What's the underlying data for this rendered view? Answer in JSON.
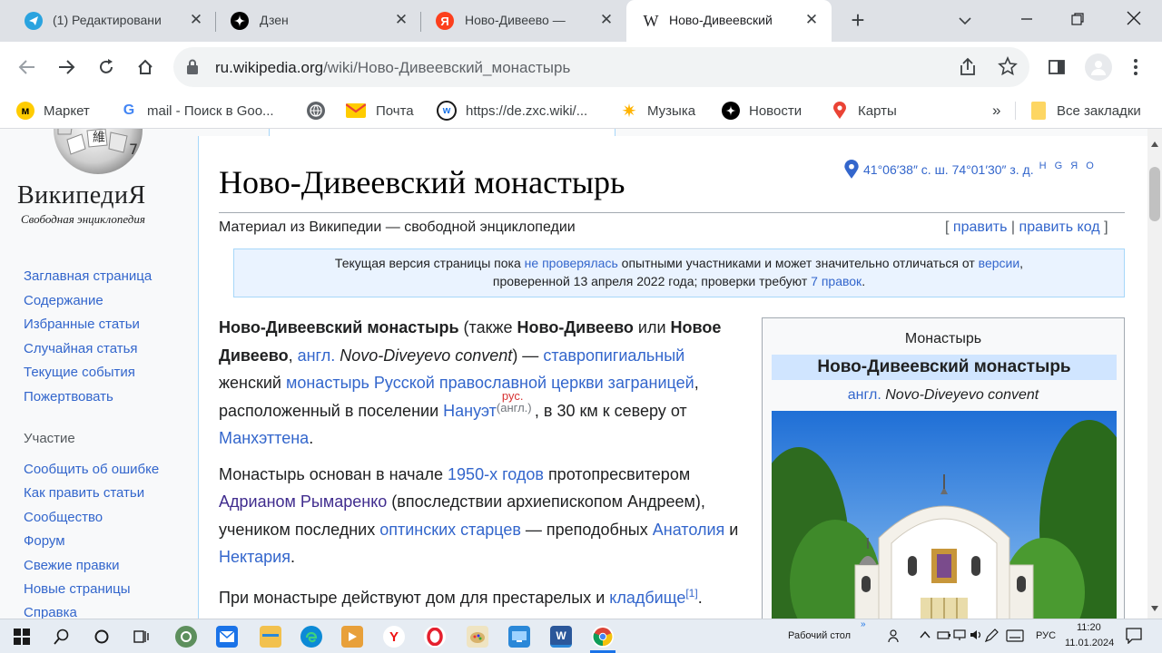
{
  "browser": {
    "tabs": [
      {
        "title": "(1) Редактировани",
        "favicon": "telegram-icon",
        "active": false
      },
      {
        "title": "Дзен",
        "favicon": "dzen-icon",
        "active": false
      },
      {
        "title": "Ново-Дивеево —",
        "favicon": "yandex-icon",
        "active": false
      },
      {
        "title": "Ново-Дивеевский",
        "favicon": "wikipedia-icon",
        "active": true
      }
    ],
    "new_tab": "+",
    "url_host": "ru.wikipedia.org",
    "url_path": "/wiki/Ново-Дивеевский_монастырь"
  },
  "bookmarks": {
    "items": [
      {
        "label": "Маркет",
        "icon": "market-icon",
        "color": "#ffcc00"
      },
      {
        "label": "mail - Поиск в Goo...",
        "icon": "google-icon",
        "color": "#4285f4"
      },
      {
        "label": "",
        "icon": "globe-icon",
        "color": "#5f6368"
      },
      {
        "label": "Почта",
        "icon": "mail-icon",
        "color": "#ea4335"
      },
      {
        "label": "https://de.zxc.wiki/...",
        "icon": "zxc-wiki-icon",
        "color": "#1a73e8"
      },
      {
        "label": "Музыка",
        "icon": "music-icon",
        "color": "#ffb300"
      },
      {
        "label": "Новости",
        "icon": "news-icon",
        "color": "#000000"
      },
      {
        "label": "Карты",
        "icon": "maps-icon",
        "color": "#ea4335"
      }
    ],
    "overflow": "»",
    "all_bookmarks": "Все закладки"
  },
  "sidebar": {
    "logo_title": "ВикипедиЯ",
    "logo_tagline": "Свободная энциклопедия",
    "nav": [
      "Заглавная страница",
      "Содержание",
      "Избранные статьи",
      "Случайная статья",
      "Текущие события",
      "Пожертвовать"
    ],
    "participation_heading": "Участие",
    "participation": [
      "Сообщить об ошибке",
      "Как править статьи",
      "Сообщество",
      "Форум",
      "Свежие правки",
      "Новые страницы",
      "Справка"
    ]
  },
  "article": {
    "title": "Ново-Дивеевский монастырь",
    "coordinates": "41°06′38″ с. ш. 74°01′30″ з. д.",
    "coord_links": "H G Я O",
    "subtitle": "Материал из Википедии — свободной энциклопедии",
    "edit": "править",
    "edit_code": "править код",
    "edit_open": "[",
    "edit_sep": "|",
    "edit_close": "]",
    "notice": {
      "t1": "Текущая версия страницы пока ",
      "l1": "не проверялась",
      "t2": " опытными участниками и может значительно отличаться от ",
      "l2": "версии",
      "t3": ",",
      "t4": "проверенной 13 апреля 2022 года; проверки требуют ",
      "l3": "7 правок",
      "t5": "."
    },
    "p1": {
      "b1": "Ново-Дивеевский монастырь",
      "t1": " (также ",
      "b2": "Ново-Дивеево",
      "t2": " или ",
      "b3": "Новое Дивеево",
      "t3": ", ",
      "l1": "англ.",
      "t4": " ",
      "i1": "Novo-Diveyevo convent",
      "t5": ") —",
      "l2": "ставропигиальный",
      "t6": " женский ",
      "l3": "монастырь Русской православной церкви заграницей",
      "t7": ", расположенный в поселении ",
      "l4": "Нануэт",
      "tag_red": "рус.",
      "tag_eng": "(англ.)",
      "t8": ", в 30 км к северу от ",
      "l5": "Манхэттена",
      "t9": "."
    },
    "p2": {
      "t1": "Монастырь основан в начале ",
      "l1": "1950-х годов",
      "t2": " протопресвитером ",
      "l2": "Адрианом Рымаренко",
      "t3": " (впоследствии архиепископом Андреем), учеником последних ",
      "l3": "оптинских старцев",
      "t4": " — преподобных ",
      "l4": "Анатолия",
      "t5": " и ",
      "l5": "Нектария",
      "t6": "."
    },
    "p3": {
      "t1": "При монастыре действуют дом для престарелых и ",
      "l1": "кладбище",
      "ref": "[1]",
      "t2": "."
    }
  },
  "infobox": {
    "caption": "Монастырь",
    "title": "Ново-Дивеевский монастырь",
    "eng_link": "англ.",
    "eng_name": "Novo-Diveyevo convent"
  },
  "taskbar": {
    "desktop_label": "Рабочий стол",
    "chevrons": "»",
    "lang": "РУС",
    "time": "11:20",
    "date": "11.01.2024"
  }
}
